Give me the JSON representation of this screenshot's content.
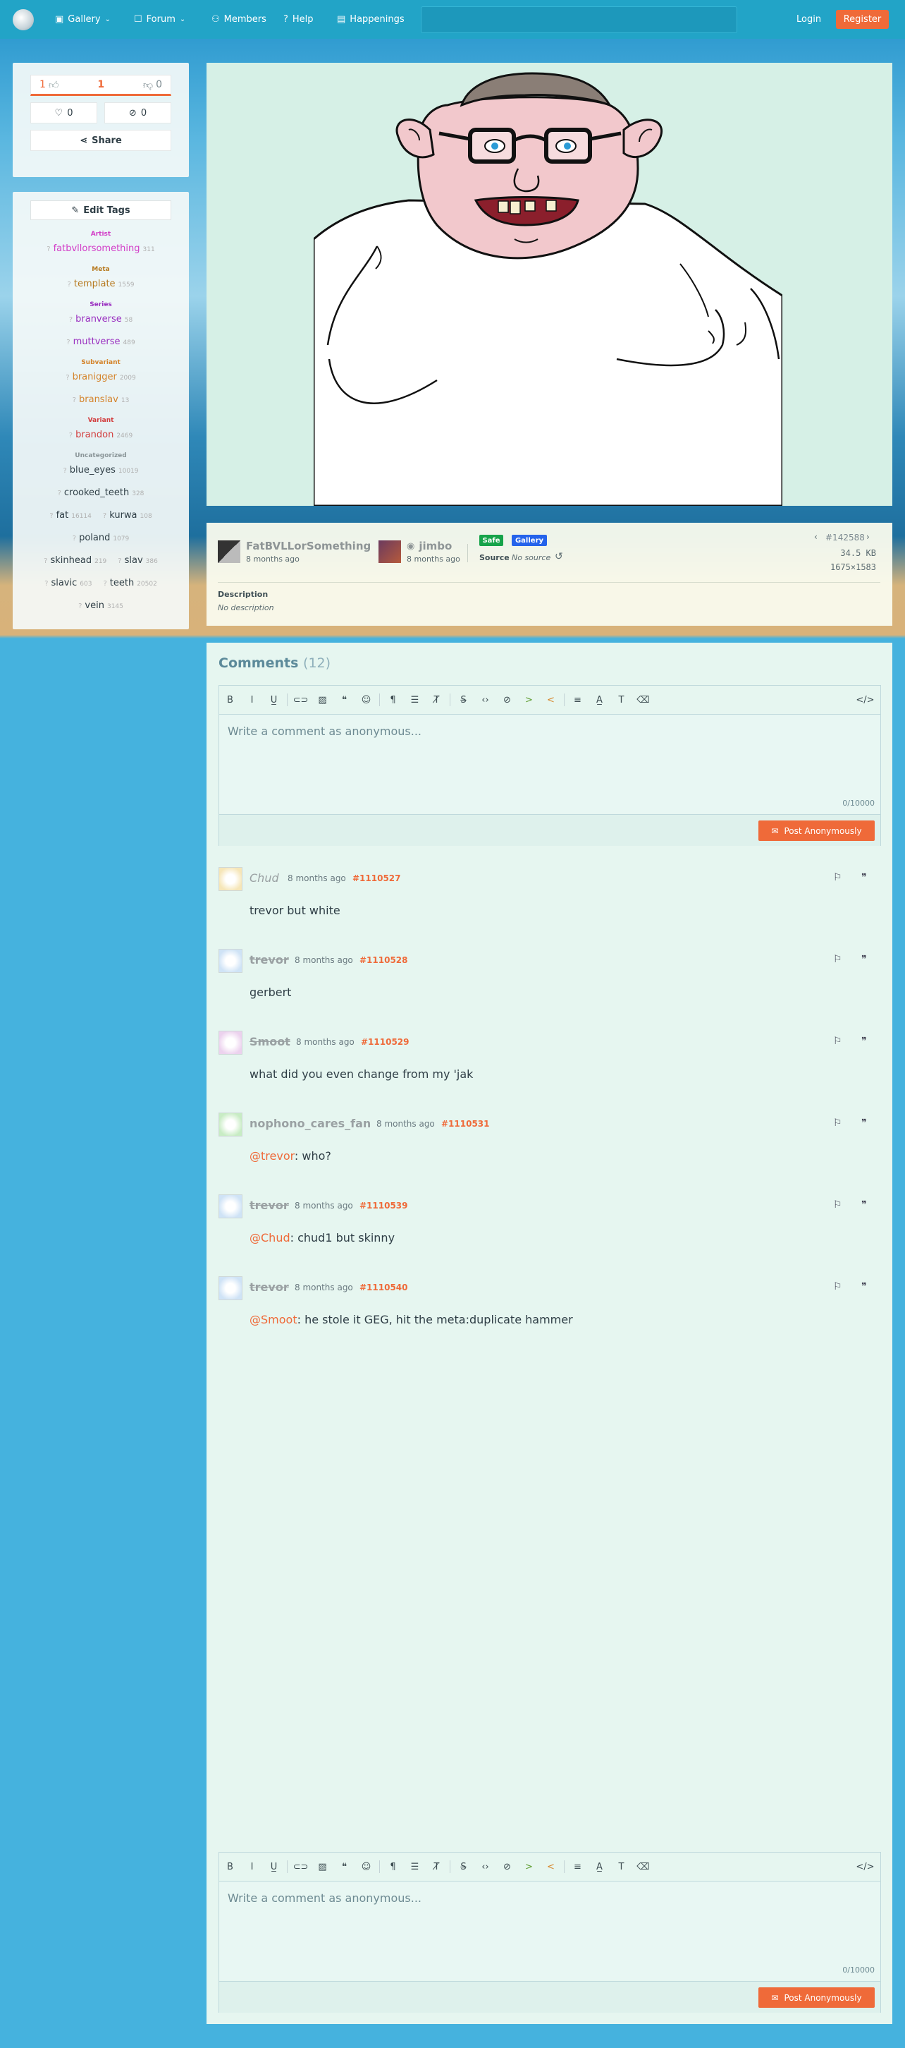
{
  "nav": {
    "items": [
      {
        "label": "Gallery",
        "icon": "gallery-icon",
        "dropdown": true
      },
      {
        "label": "Forum",
        "icon": "forum-icon",
        "dropdown": true
      },
      {
        "label": "Members",
        "icon": "user-icon",
        "dropdown": false
      },
      {
        "label": "Help",
        "icon": "help-icon",
        "dropdown": false
      },
      {
        "label": "Happenings",
        "icon": "book-icon",
        "dropdown": false
      }
    ],
    "search_placeholder": "",
    "login": "Login",
    "register": "Register"
  },
  "votes": {
    "score": "1",
    "up": "1",
    "down": "0",
    "favorites": "0",
    "hidden": "0",
    "share": "Share"
  },
  "tags": {
    "edit_label": "Edit Tags",
    "groups": [
      {
        "category": "Artist",
        "color": "#d23cc7",
        "rows": [
          [
            {
              "name": "fatbvllorsomething",
              "count": "311"
            }
          ]
        ]
      },
      {
        "category": "Meta",
        "color": "#b77a20",
        "rows": [
          [
            {
              "name": "template",
              "count": "1559"
            }
          ]
        ]
      },
      {
        "category": "Series",
        "color": "#9a30c0",
        "rows": [
          [
            {
              "name": "branverse",
              "count": "58"
            }
          ],
          [
            {
              "name": "muttverse",
              "count": "489"
            }
          ]
        ]
      },
      {
        "category": "Subvariant",
        "color": "#d4832a",
        "rows": [
          [
            {
              "name": "branigger",
              "count": "2009"
            }
          ],
          [
            {
              "name": "branslav",
              "count": "13"
            }
          ]
        ]
      },
      {
        "category": "Variant",
        "color": "#d23c3c",
        "rows": [
          [
            {
              "name": "brandon",
              "count": "2469"
            }
          ]
        ]
      },
      {
        "category": "Uncategorized",
        "color": "#8a9598",
        "rows": [
          [
            {
              "name": "blue_eyes",
              "count": "10019"
            }
          ],
          [
            {
              "name": "crooked_teeth",
              "count": "328"
            }
          ],
          [
            {
              "name": "fat",
              "count": "16114"
            },
            {
              "name": "kurwa",
              "count": "108"
            }
          ],
          [
            {
              "name": "poland",
              "count": "1079"
            }
          ],
          [
            {
              "name": "skinhead",
              "count": "219"
            },
            {
              "name": "slav",
              "count": "386"
            }
          ],
          [
            {
              "name": "slavic",
              "count": "603"
            },
            {
              "name": "teeth",
              "count": "20502"
            }
          ],
          [
            {
              "name": "vein",
              "count": "3145"
            }
          ]
        ]
      }
    ]
  },
  "post": {
    "uploader": "FatBVLLorSomething",
    "uploader_time": "8 months ago",
    "approver": "jimbo",
    "approver_time": "8 months ago",
    "rating": "Safe",
    "rating_color": "#16a34a",
    "board": "Gallery",
    "board_color": "#2563eb",
    "source_label": "Source",
    "source_value": "No source",
    "id": "#142588",
    "size": "34.5 KB",
    "dimensions": "1675×1583",
    "description_label": "Description",
    "description_value": "No description"
  },
  "comments": {
    "title": "Comments",
    "count": "(12)",
    "placeholder": "Write a comment as anonymous...",
    "char_count": "0/10000",
    "post_button": "Post Anonymously",
    "list": [
      {
        "author": "Chud",
        "style": "italic",
        "avatar": "#f6e6b8",
        "time": "8 months ago",
        "id": "#1110527",
        "mention": "",
        "text": "trevor but white"
      },
      {
        "author": "trevor",
        "style": "strike",
        "avatar": "#cfe3f6",
        "time": "8 months ago",
        "id": "#1110528",
        "mention": "",
        "text": "gerbert"
      },
      {
        "author": "Smoot",
        "style": "strike",
        "avatar": "#ecd2ee",
        "time": "8 months ago",
        "id": "#1110529",
        "mention": "",
        "text": "what did you even change from my 'jak"
      },
      {
        "author": "nophono_cares_fan",
        "style": "bold",
        "avatar": "#c8ecc4",
        "time": "8 months ago",
        "id": "#1110531",
        "mention": "@trevor",
        "text": ": who?"
      },
      {
        "author": "trevor",
        "style": "strike",
        "avatar": "#cfe3f6",
        "time": "8 months ago",
        "id": "#1110539",
        "mention": "@Chud",
        "text": ": chud1 but skinny"
      },
      {
        "author": "trevor",
        "style": "strike",
        "avatar": "#cfe3f6",
        "time": "8 months ago",
        "id": "#1110540",
        "mention": "@Smoot",
        "text": ": he stole it GEG, hit the meta:duplicate hammer"
      }
    ]
  }
}
